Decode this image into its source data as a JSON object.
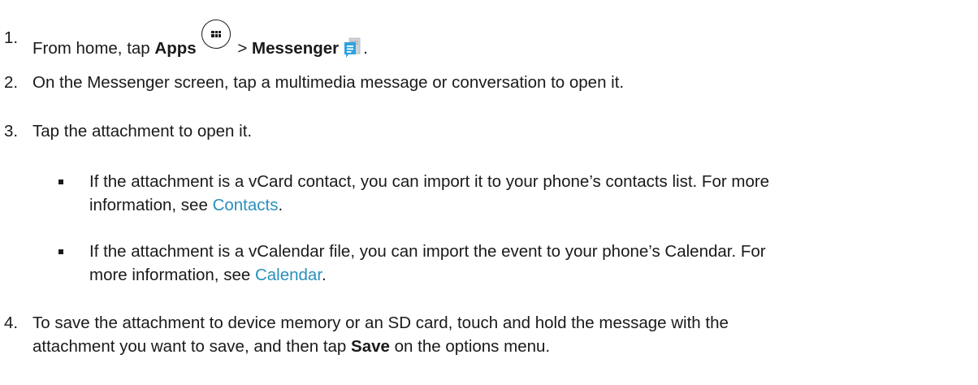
{
  "steps": [
    {
      "num": "1.",
      "pre": "From home, tap ",
      "bold1": "Apps",
      "mid": " > ",
      "bold2": "Messenger",
      "post": "."
    },
    {
      "num": "2.",
      "text": "On the Messenger screen, tap a multimedia message or conversation to open it."
    },
    {
      "num": "3.",
      "text": "Tap the attachment to open it.",
      "subitems": [
        {
          "line1": "If the attachment is a vCard contact, you can import it to your phone’s contacts list. For more",
          "line2_pre": "information, see ",
          "link": "Contacts",
          "line2_post": "."
        },
        {
          "line1": "If the attachment is a vCalendar file, you can import the event to your phone’s Calendar. For",
          "line2_pre": "more information, see ",
          "link": "Calendar",
          "line2_post": "."
        }
      ]
    },
    {
      "num": "4.",
      "line1": "To save the attachment to device memory or an SD card, touch and hold the message with the",
      "line2_pre": "attachment you want to save, and then tap ",
      "bold": "Save",
      "line2_post": " on the options menu."
    }
  ],
  "icons": {
    "apps": "apps-grid-icon",
    "messenger": "messenger-icon"
  },
  "colors": {
    "link": "#2a8fbd",
    "text": "#1a1a1a",
    "messenger_icon": "#2fa3e0"
  }
}
